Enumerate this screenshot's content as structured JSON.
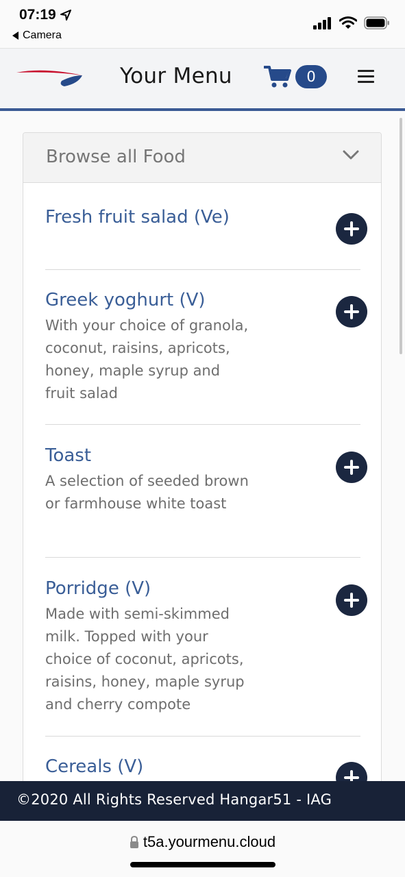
{
  "status_bar": {
    "time": "07:19",
    "back_app": "Camera",
    "icons": [
      "location-arrow-icon",
      "signal-icon",
      "wifi-icon",
      "battery-icon"
    ]
  },
  "header": {
    "title": "Your Menu",
    "cart_count": "0",
    "icons": [
      "logo-icon",
      "cart-icon",
      "hamburger-menu-icon"
    ],
    "accent_color": "#264a8a"
  },
  "menu": {
    "category": "Browse all Food",
    "items": [
      {
        "title": "Fresh fruit salad (Ve)",
        "description": ""
      },
      {
        "title": "Greek yoghurt (V)",
        "description": "With your choice of granola, coconut, raisins, apricots, honey, maple syrup and fruit salad"
      },
      {
        "title": "Toast",
        "description": "A selection of seeded brown or farmhouse white toast"
      },
      {
        "title": "Porridge (V)",
        "description": "Made with semi-skimmed milk. Topped with your choice of coconut, apricots, raisins, honey, maple syrup and cherry compote"
      },
      {
        "title": "Cereals (V)",
        "description": ""
      }
    ]
  },
  "footer": {
    "text": "©2020 All Rights Reserved Hangar51 - IAG",
    "background": "#182237"
  },
  "browser": {
    "url": "t5a.yourmenu.cloud"
  }
}
